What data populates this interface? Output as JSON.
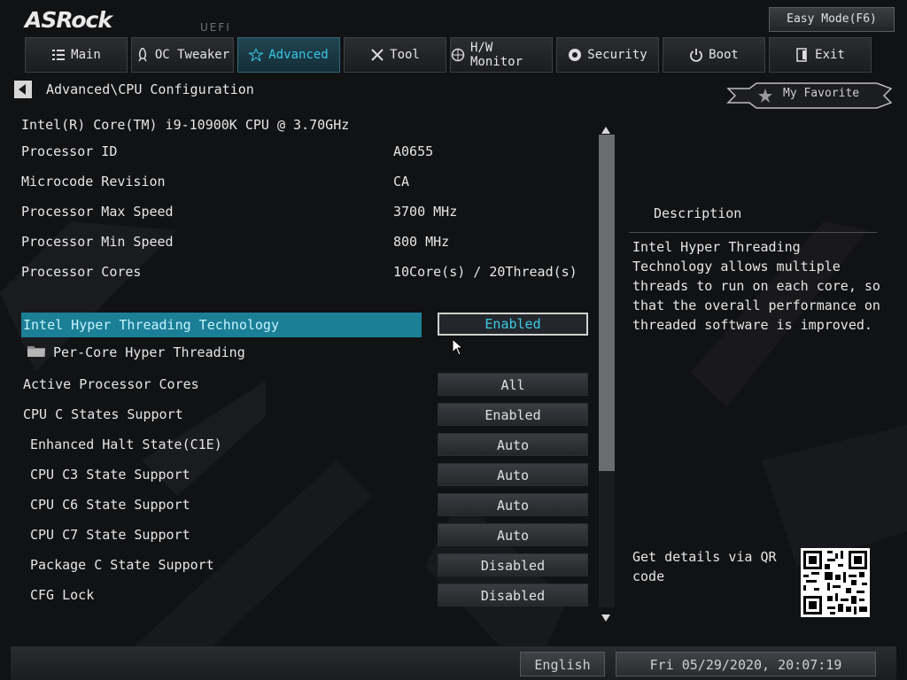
{
  "header": {
    "brand": "ASRock",
    "uefi_label": "UEFI",
    "easy_mode_label": "Easy Mode(F6)"
  },
  "tabs": [
    {
      "label": "Main",
      "icon": "list-icon",
      "active": false
    },
    {
      "label": "OC Tweaker",
      "icon": "rocket-icon",
      "active": false
    },
    {
      "label": "Advanced",
      "icon": "star-icon",
      "active": true
    },
    {
      "label": "Tool",
      "icon": "wrench-icon",
      "active": false
    },
    {
      "label": "H/W Monitor",
      "icon": "monitor-icon",
      "active": false
    },
    {
      "label": "Security",
      "icon": "shield-icon",
      "active": false
    },
    {
      "label": "Boot",
      "icon": "power-icon",
      "active": false
    },
    {
      "label": "Exit",
      "icon": "exit-icon",
      "active": false
    }
  ],
  "breadcrumb": "Advanced\\CPU Configuration",
  "favorite_label": "My Favorite",
  "cpu_name": "Intel(R) Core(TM) i9-10900K CPU @ 3.70GHz",
  "info": [
    {
      "label": "Processor ID",
      "value": "A0655"
    },
    {
      "label": "Microcode Revision",
      "value": "CA"
    },
    {
      "label": "Processor Max Speed",
      "value": "3700 MHz"
    },
    {
      "label": "Processor Min Speed",
      "value": "800 MHz"
    },
    {
      "label": "Processor Cores",
      "value": "10Core(s) / 20Thread(s)"
    }
  ],
  "options": {
    "hyper_threading": {
      "label": "Intel Hyper Threading Technology",
      "value": "Enabled"
    },
    "per_core_ht": {
      "label": "Per-Core Hyper Threading"
    },
    "active_cores": {
      "label": "Active Processor Cores",
      "value": "All"
    },
    "c_states": {
      "label": "CPU C States Support",
      "value": "Enabled"
    },
    "c1e": {
      "label": "Enhanced Halt State(C1E)",
      "value": "Auto"
    },
    "c3": {
      "label": "CPU C3 State Support",
      "value": "Auto"
    },
    "c6": {
      "label": "CPU C6 State Support",
      "value": "Auto"
    },
    "c7": {
      "label": "CPU C7 State Support",
      "value": "Auto"
    },
    "package_c": {
      "label": "Package C State Support",
      "value": "Disabled"
    },
    "cfg_lock": {
      "label": "CFG Lock",
      "value": "Disabled"
    }
  },
  "description": {
    "title": "Description",
    "text": "Intel Hyper Threading Technology allows multiple threads to run on each core, so that the overall performance on threaded software is improved.",
    "qr_text": "Get details via QR code"
  },
  "footer": {
    "language": "English",
    "datetime": "Fri 05/29/2020, 20:07:19"
  },
  "colors": {
    "accent": "#38c6e6",
    "selected_row": "#1b7f96",
    "background": "#111214"
  }
}
